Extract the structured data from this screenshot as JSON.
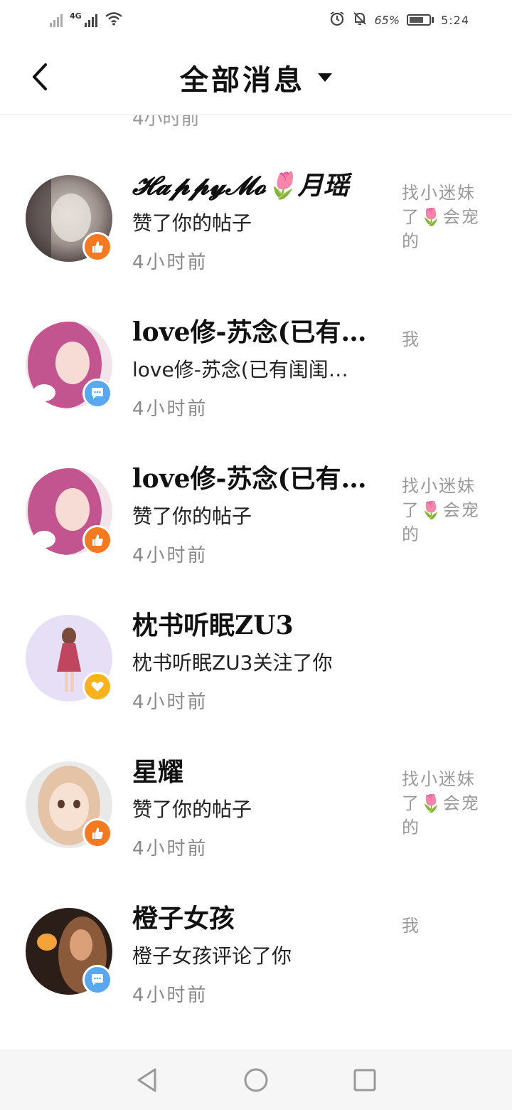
{
  "status_bar": {
    "network": "4G",
    "battery": "65%",
    "time": "5:24"
  },
  "header": {
    "title": "全部消息"
  },
  "partial_row_text": "4小时前",
  "messages": [
    {
      "name": "𝓗𝓪𝓹𝓹𝔂𝓜𝓸🌷月瑶",
      "action": "赞了你的帖子",
      "time": "4小时前",
      "snippet": "找小迷妹了🌷会宠的",
      "badge": "like",
      "avatar_colors": [
        "#4a4040",
        "#9a8f8a",
        "#d6d0cc"
      ]
    },
    {
      "name": "love修-苏念(已有…",
      "action": "love修-苏念(已有闺闺…",
      "time": "4小时前",
      "snippet": "我",
      "badge": "comment",
      "avatar_colors": [
        "#7c2b5a",
        "#c2558f",
        "#f3d3e1"
      ]
    },
    {
      "name": "love修-苏念(已有…",
      "action": "赞了你的帖子",
      "time": "4小时前",
      "snippet": "找小迷妹了🌷会宠的",
      "badge": "like",
      "avatar_colors": [
        "#7c2b5a",
        "#c2558f",
        "#f3d3e1"
      ]
    },
    {
      "name": "枕书听眠ZU3",
      "action": "枕书听眠ZU3关注了你",
      "time": "4小时前",
      "snippet": "",
      "badge": "follow",
      "avatar_colors": [
        "#e6dff6",
        "#d7cbf0",
        "#c0455e"
      ]
    },
    {
      "name": "星耀",
      "action": "赞了你的帖子",
      "time": "4小时前",
      "snippet": "找小迷妹了🌷会宠的",
      "badge": "like",
      "avatar_colors": [
        "#e9e9e9",
        "#e4c3a6",
        "#9b6b4b"
      ]
    },
    {
      "name": "橙子女孩",
      "action": "橙子女孩评论了你",
      "time": "4小时前",
      "snippet": "我",
      "badge": "comment",
      "avatar_colors": [
        "#2b1d18",
        "#8a5a3a",
        "#f5a23b"
      ]
    }
  ],
  "colors": {
    "like": "#f47a21",
    "comment": "#59a8ef",
    "follow": "#f7b21e"
  }
}
